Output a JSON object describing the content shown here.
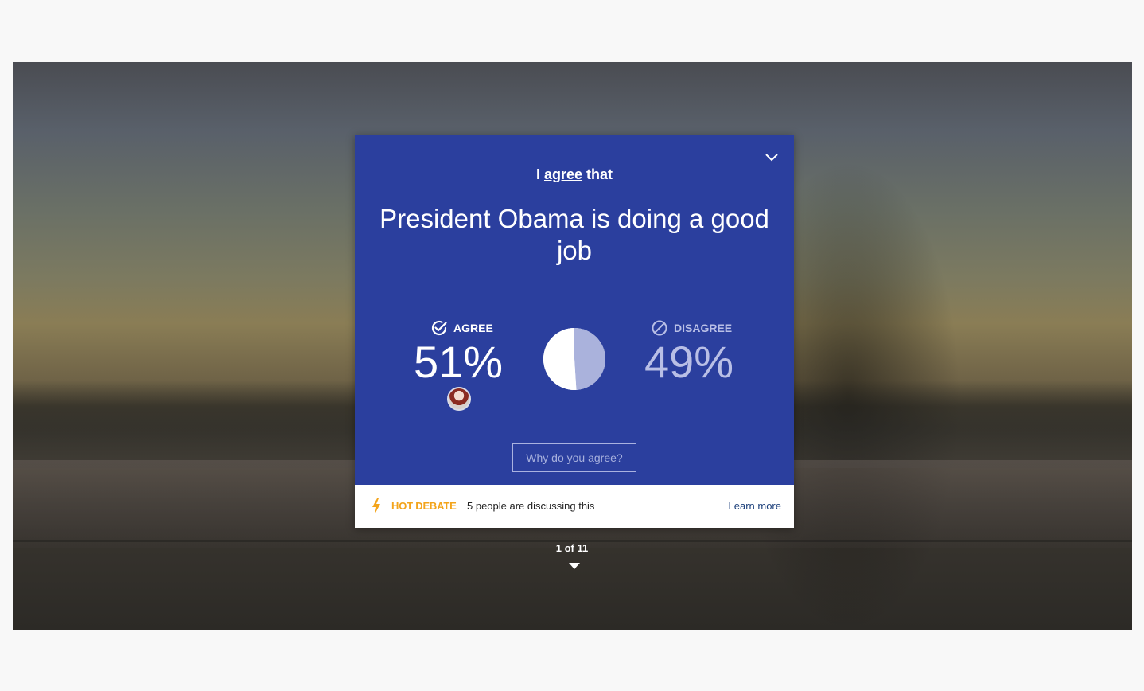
{
  "card": {
    "prefix_before": "I ",
    "prefix_link": "agree",
    "prefix_after": " that",
    "statement": "President Obama is doing a good job",
    "agree": {
      "label": "AGREE",
      "percent_text": "51%",
      "percent": 51,
      "color": "#ffffff"
    },
    "disagree": {
      "label": "DISAGREE",
      "percent_text": "49%",
      "percent": 49,
      "color": "#aab2dc"
    },
    "why_button": "Why do you agree?",
    "background_color": "#2b3f9e"
  },
  "footer": {
    "hot_label": "HOT DEBATE",
    "discussing": "5 people are discussing this",
    "learn_more": "Learn more",
    "accent_color": "#f3a41b"
  },
  "pager": {
    "text": "1 of 11"
  },
  "icons": {
    "collapse": "chevron-down-icon",
    "agree": "check-circle-icon",
    "disagree": "ban-icon",
    "hot": "bolt-icon",
    "next": "caret-down-icon"
  }
}
